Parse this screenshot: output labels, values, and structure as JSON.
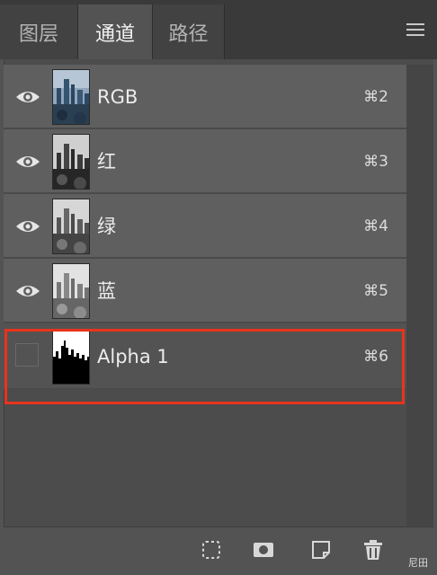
{
  "tabs": [
    {
      "label": "图层",
      "active": false
    },
    {
      "label": "通道",
      "active": true
    },
    {
      "label": "路径",
      "active": false
    }
  ],
  "channels": [
    {
      "name": "RGB",
      "shortcut": "⌘2",
      "visible": true,
      "thumbnail": "color"
    },
    {
      "name": "红",
      "shortcut": "⌘3",
      "visible": true,
      "thumbnail": "grayscale-dark"
    },
    {
      "name": "绿",
      "shortcut": "⌘4",
      "visible": true,
      "thumbnail": "grayscale"
    },
    {
      "name": "蓝",
      "shortcut": "⌘5",
      "visible": true,
      "thumbnail": "grayscale-light"
    },
    {
      "name": "Alpha 1",
      "shortcut": "⌘6",
      "visible": false,
      "thumbnail": "alpha-mask",
      "highlighted": true
    }
  ],
  "toolbar": {
    "icons": [
      "load-selection-icon",
      "save-selection-icon",
      "new-channel-icon",
      "delete-channel-icon"
    ]
  },
  "watermark": "尼田",
  "colors": {
    "highlight": "#e8341c",
    "panel_bg": "#535353",
    "row_bg": "#5f5f5f"
  }
}
